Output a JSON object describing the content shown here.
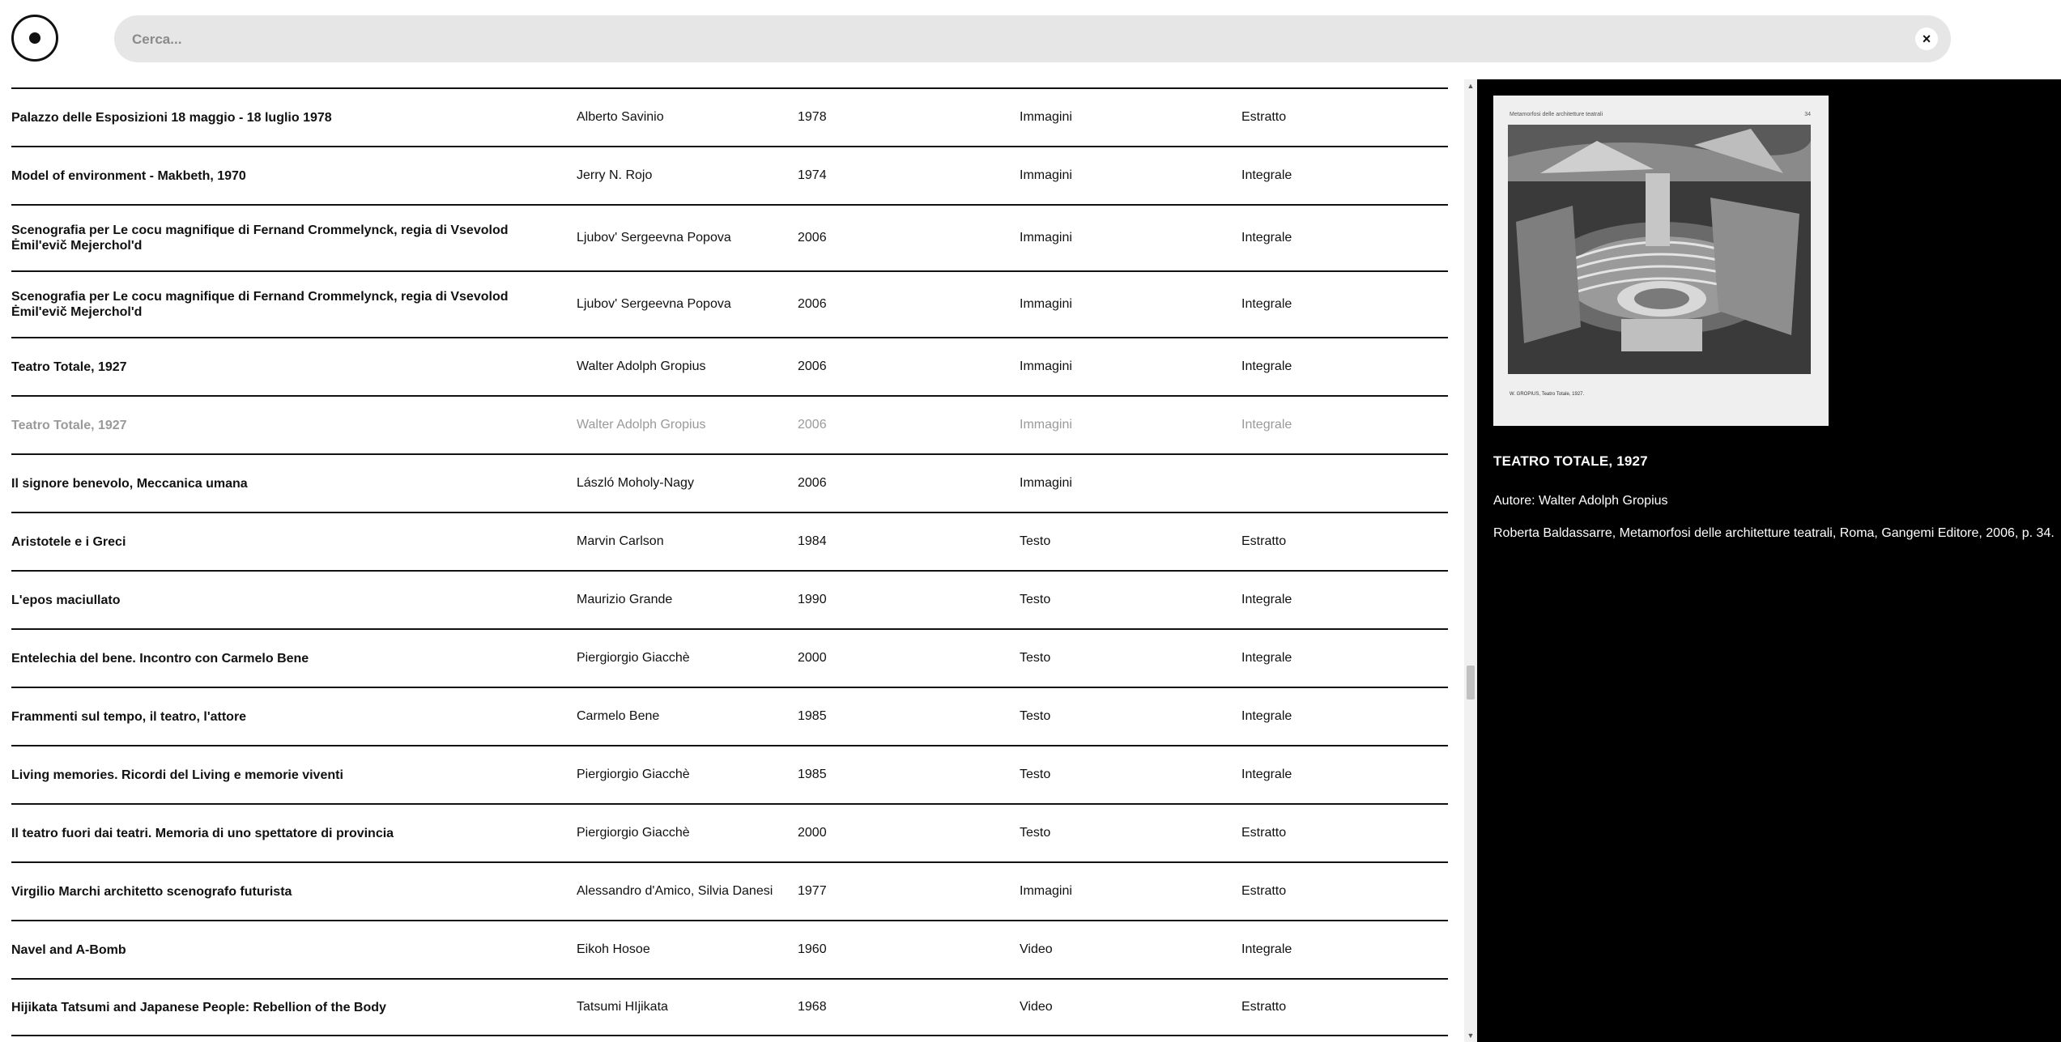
{
  "search": {
    "placeholder": "Cerca...",
    "clear_label": "×"
  },
  "rows": [
    {
      "title": "Palazzo delle Esposizioni 18 maggio - 18 luglio 1978",
      "author": "Alberto Savinio",
      "year": "1978",
      "type": "Immagini",
      "access": "Estratto"
    },
    {
      "title": "Model of environment - Makbeth, 1970",
      "author": "Jerry N. Rojo",
      "year": "1974",
      "type": "Immagini",
      "access": "Integrale"
    },
    {
      "title": "Scenografia per Le cocu magnifique di Fernand Crommelynck, regia di Vsevolod Ėmil'evič Mejerchol'd",
      "author": "Ljubov' Sergeevna Popova",
      "year": "2006",
      "type": "Immagini",
      "access": "Integrale"
    },
    {
      "title": "Scenografia per Le cocu magnifique di Fernand Crommelynck, regia di Vsevolod Ėmil'evič Mejerchol'd",
      "author": "Ljubov' Sergeevna Popova",
      "year": "2006",
      "type": "Immagini",
      "access": "Integrale"
    },
    {
      "title": "Teatro Totale, 1927",
      "author": "Walter Adolph Gropius",
      "year": "2006",
      "type": "Immagini",
      "access": "Integrale"
    },
    {
      "title": "Teatro Totale, 1927",
      "author": "Walter Adolph Gropius",
      "year": "2006",
      "type": "Immagini",
      "access": "Integrale"
    },
    {
      "title": "Il signore benevolo, Meccanica umana",
      "author": "László Moholy-Nagy",
      "year": "2006",
      "type": "Immagini",
      "access": ""
    },
    {
      "title": "Aristotele e i Greci",
      "author": "Marvin Carlson",
      "year": "1984",
      "type": "Testo",
      "access": "Estratto"
    },
    {
      "title": "L'epos maciullato",
      "author": "Maurizio Grande",
      "year": "1990",
      "type": "Testo",
      "access": "Integrale"
    },
    {
      "title": "Entelechia del bene. Incontro con Carmelo Bene",
      "author": "Piergiorgio Giacchè",
      "year": "2000",
      "type": "Testo",
      "access": "Integrale"
    },
    {
      "title": "Frammenti sul tempo, il teatro, l'attore",
      "author": "Carmelo Bene",
      "year": "1985",
      "type": "Testo",
      "access": "Integrale"
    },
    {
      "title": "Living memories. Ricordi del Living e memorie viventi",
      "author": "Piergiorgio Giacchè",
      "year": "1985",
      "type": "Testo",
      "access": "Integrale"
    },
    {
      "title": "Il teatro fuori dai teatri. Memoria di uno spettatore di provincia",
      "author": "Piergiorgio Giacchè",
      "year": "2000",
      "type": "Testo",
      "access": "Estratto"
    },
    {
      "title": "Virgilio Marchi architetto scenografo futurista",
      "author": "Alessandro d'Amico, Silvia Danesi",
      "year": "1977",
      "type": "Immagini",
      "access": "Estratto"
    },
    {
      "title": "Navel and A-Bomb",
      "author": "Eikoh Hosoe",
      "year": "1960",
      "type": "Video",
      "access": "Integrale"
    },
    {
      "title": "Hijikata Tatsumi and Japanese People: Rebellion of the Body",
      "author": "Tatsumi HIjikata",
      "year": "1968",
      "type": "Video",
      "access": "Estratto"
    }
  ],
  "scrollbar": {
    "up_glyph": "▲",
    "down_glyph": "▼"
  },
  "detail": {
    "thumb_header": "Metamorfosi delle architetture teatrali",
    "thumb_page": "34",
    "thumb_caption": "W. GROPIUS, Teatro Totale, 1927.",
    "title": "TEATRO TOTALE, 1927",
    "author": "Autore: Walter Adolph Gropius",
    "reference": "Roberta Baldassarre, Metamorfosi delle architetture teatrali, Roma, Gangemi Editore, 2006, p. 34."
  }
}
